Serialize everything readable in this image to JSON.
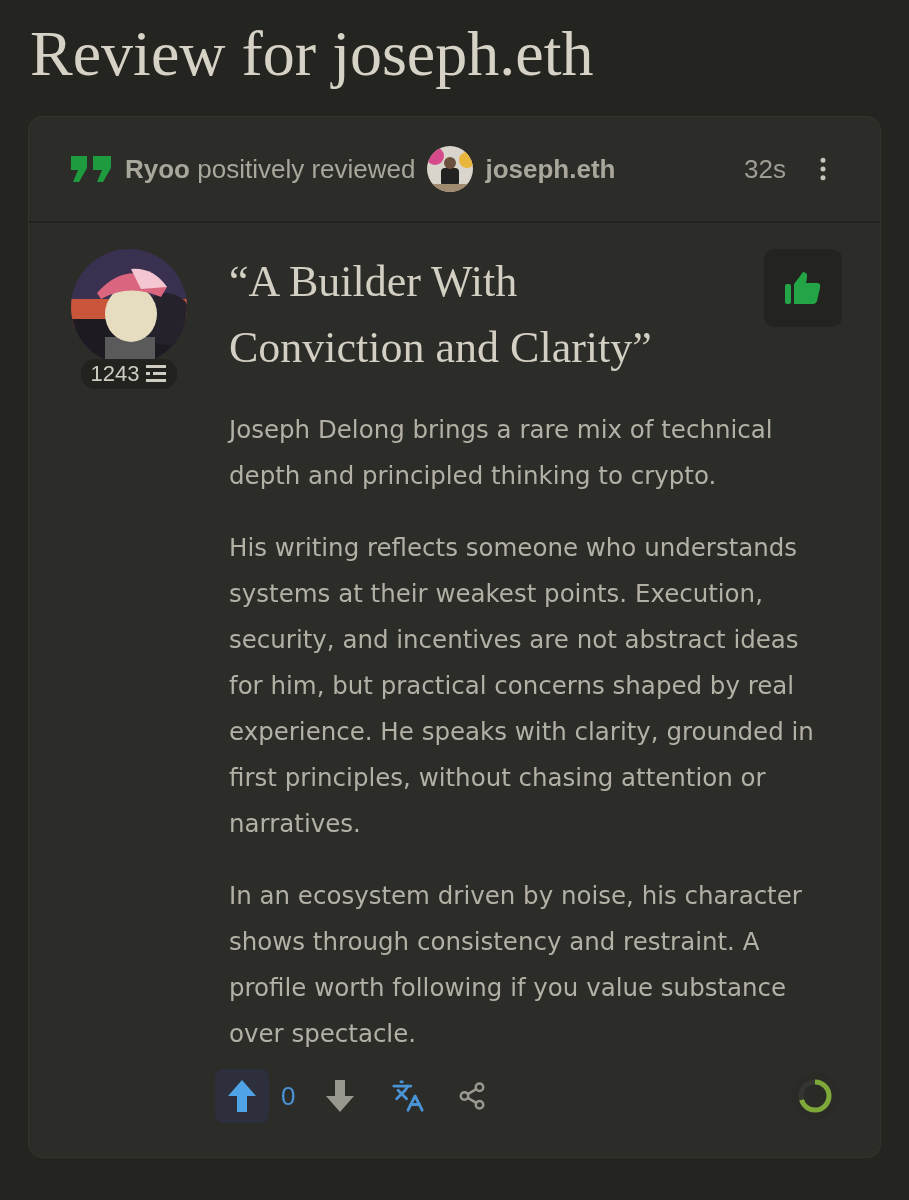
{
  "page": {
    "title": "Review for joseph.eth"
  },
  "review": {
    "reviewer": "Ryoo",
    "action": "positively reviewed",
    "subject": "joseph.eth",
    "time": "32s",
    "positive": true,
    "reviewer_score": "1243",
    "title": "“A Builder With Conviction and Clarity”",
    "paragraphs": [
      "Joseph Delong brings a rare mix of technical depth and principled thinking to crypto.",
      "His writing reflects someone who understands systems at their weakest points. Execution, security, and incentives are not abstract ideas for him, but practical concerns shaped by real experience. He speaks with clarity, grounded in first principles, without chasing attention or narratives.",
      "In an ecosystem driven by noise, his character shows through consistency and restraint. A profile worth following if you value substance over spectacle."
    ],
    "votes": {
      "upvoted": true,
      "downvoted": false,
      "count": "0"
    },
    "progress": {
      "level": 0.7
    }
  }
}
